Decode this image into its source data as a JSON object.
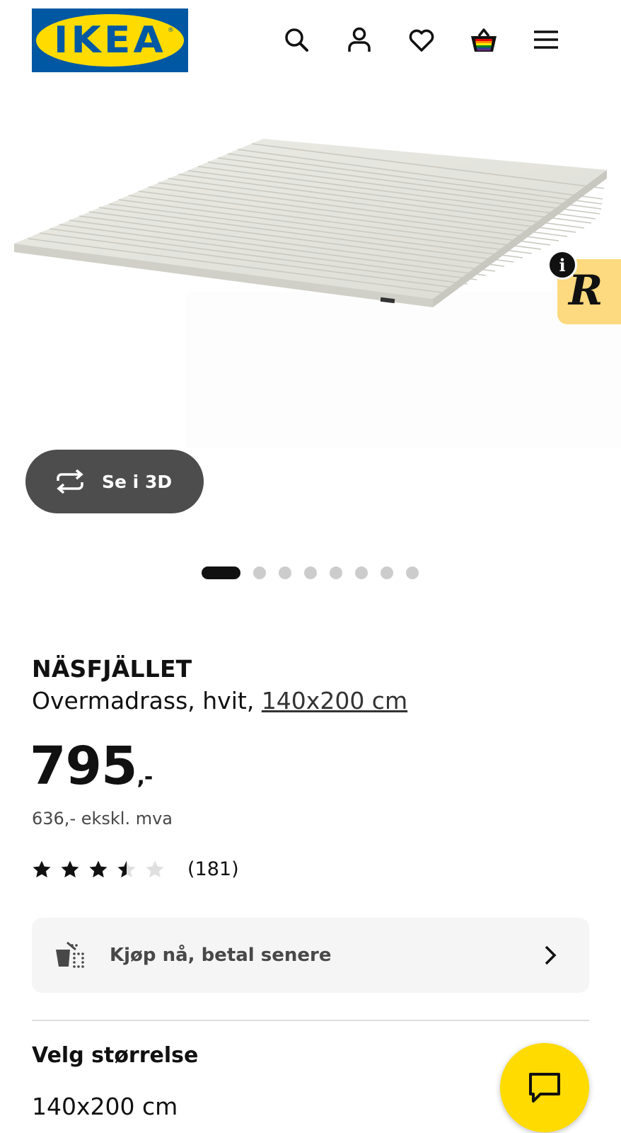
{
  "header": {
    "logo_text": "IKEA",
    "logo_reg": "®",
    "icons": [
      "search-icon",
      "user-icon",
      "heart-icon",
      "basket-icon",
      "menu-icon"
    ]
  },
  "gallery": {
    "view_3d_label": "Se i 3D",
    "slide_count": 8,
    "active_slide": 1
  },
  "side_badge": {
    "letter": "R",
    "info": "i"
  },
  "product": {
    "name": "NÄSFJÄLLET",
    "description": "Overmadrass, hvit,",
    "size_link": "140x200 cm",
    "price": "795",
    "price_suffix": ",-",
    "price_ex_vat": "636,- ekskl. mva",
    "rating": 3.5,
    "rating_max": 5,
    "review_count": "(181)"
  },
  "payment": {
    "label": "Kjøp nå, betal senere"
  },
  "size": {
    "heading": "Velg størrelse",
    "selected": "140x200 cm"
  },
  "colors": {
    "ikea_blue": "#0058a3",
    "ikea_yellow": "#ffdb00",
    "badge_yellow": "#fdd97f",
    "button_gray": "#4d4d4d"
  }
}
